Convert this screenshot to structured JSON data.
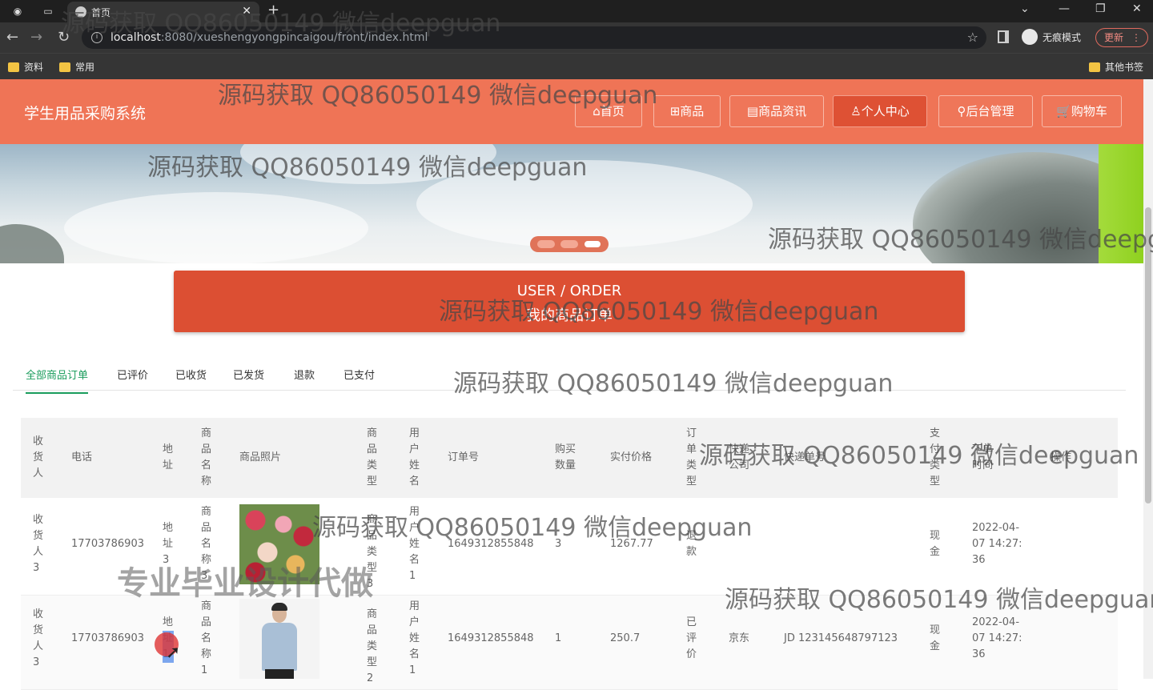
{
  "browser": {
    "tab_title": "首页",
    "url_host": "localhost",
    "url_path": ":8080/xueshengyongpincaigou/front/index.html",
    "incognito_label": "无痕模式",
    "update_label": "更新",
    "bookmarks": [
      "资料",
      "常用"
    ],
    "other_bookmarks": "其他书签"
  },
  "site": {
    "title": "学生用品采购系统",
    "nav": [
      {
        "label": "⌂首页"
      },
      {
        "label": "⊞商品"
      },
      {
        "label": "▤商品资讯"
      },
      {
        "label": "♙个人中心"
      },
      {
        "label": "⚲后台管理"
      },
      {
        "label": "🛒购物车"
      }
    ]
  },
  "order_banner": {
    "en": "USER / ORDER",
    "zh": "我的商品订单"
  },
  "tabs": [
    "全部商品订单",
    "已评价",
    "已收货",
    "已发货",
    "退款",
    "已支付"
  ],
  "table": {
    "headers": [
      "收货人",
      "电话",
      "地址",
      "商品名称",
      "商品照片",
      "商品类型",
      "用户姓名",
      "订单号",
      "购买数量",
      "实付价格",
      "订单类型",
      "快递公司",
      "快递单号",
      "支付类型",
      "下单时间",
      "操作"
    ],
    "rows": [
      {
        "receiver": "收货人3",
        "phone": "17703786903",
        "address": "地址3",
        "product": "商品名称3",
        "photo": "flowers-photo",
        "type": "商品类型3",
        "user": "用户姓名1",
        "order_no": "1649312855848",
        "qty": "3",
        "price": "1267.77",
        "status": "退款",
        "courier": "",
        "tracking": "",
        "pay_type": "现金",
        "time": "2022-04-07 14:27:36"
      },
      {
        "receiver": "收货人3",
        "phone": "17703786903",
        "address": "地址1",
        "product": "商品名称1",
        "photo": "man-photo",
        "type": "商品类型2",
        "user": "用户姓名1",
        "order_no": "1649312855848",
        "qty": "1",
        "price": "250.7",
        "status": "已评价",
        "courier": "京东",
        "tracking": "JD 123145648797123",
        "pay_type": "现金",
        "time": "2022-04-07 14:27:36"
      }
    ]
  },
  "watermarks": {
    "text": "源码获取 QQ86050149 微信deepguan",
    "big": "专业毕业设计代做"
  },
  "colors": {
    "header": "#ef7456",
    "active_nav": "#de5134",
    "order_banner": "#dc4f33",
    "tab_active": "#1a9c5c"
  }
}
